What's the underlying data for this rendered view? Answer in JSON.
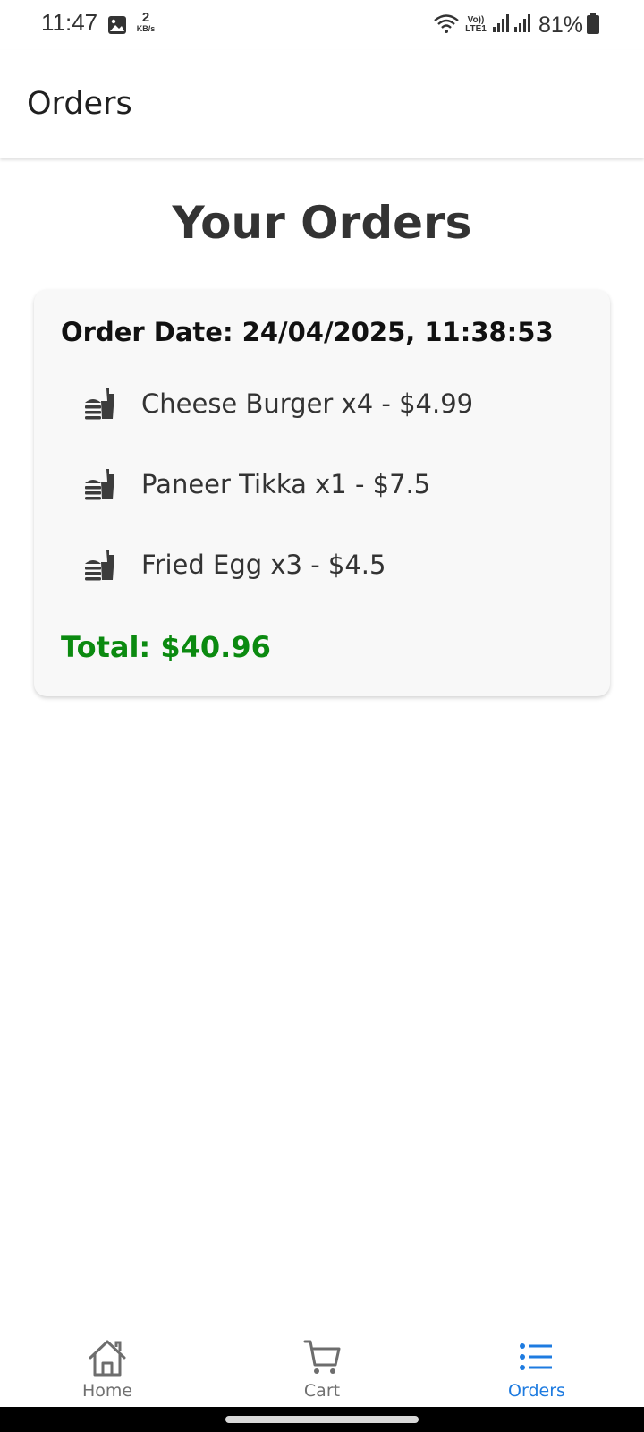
{
  "status_bar": {
    "time": "11:47",
    "net_speed_value": "2",
    "net_speed_unit": "KB/s",
    "volte_label": "Vo))",
    "lte_label": "LTE1",
    "battery": "81%",
    "icons": [
      "gallery-icon",
      "wifi-icon",
      "signal-icon",
      "signal-icon",
      "battery-icon"
    ]
  },
  "app_bar": {
    "title": "Orders"
  },
  "main": {
    "heading": "Your Orders",
    "orders": [
      {
        "date_label": "Order Date: 24/04/2025, 11:38:53",
        "items": [
          {
            "text": "Cheese Burger x4 - $4.99",
            "icon": "fastfood-icon"
          },
          {
            "text": "Paneer Tikka x1 - $7.5",
            "icon": "fastfood-icon"
          },
          {
            "text": "Fried Egg x3 - $4.5",
            "icon": "fastfood-icon"
          }
        ],
        "total": "Total: $40.96"
      }
    ]
  },
  "bottom_nav": {
    "items": [
      {
        "label": "Home",
        "icon": "home-icon",
        "active": false
      },
      {
        "label": "Cart",
        "icon": "cart-icon",
        "active": false
      },
      {
        "label": "Orders",
        "icon": "list-icon",
        "active": true
      }
    ]
  },
  "colors": {
    "accent": "#1e7be0",
    "total": "#0b8a10",
    "card_bg": "#f8f8f8",
    "inactive_nav": "#707070"
  }
}
